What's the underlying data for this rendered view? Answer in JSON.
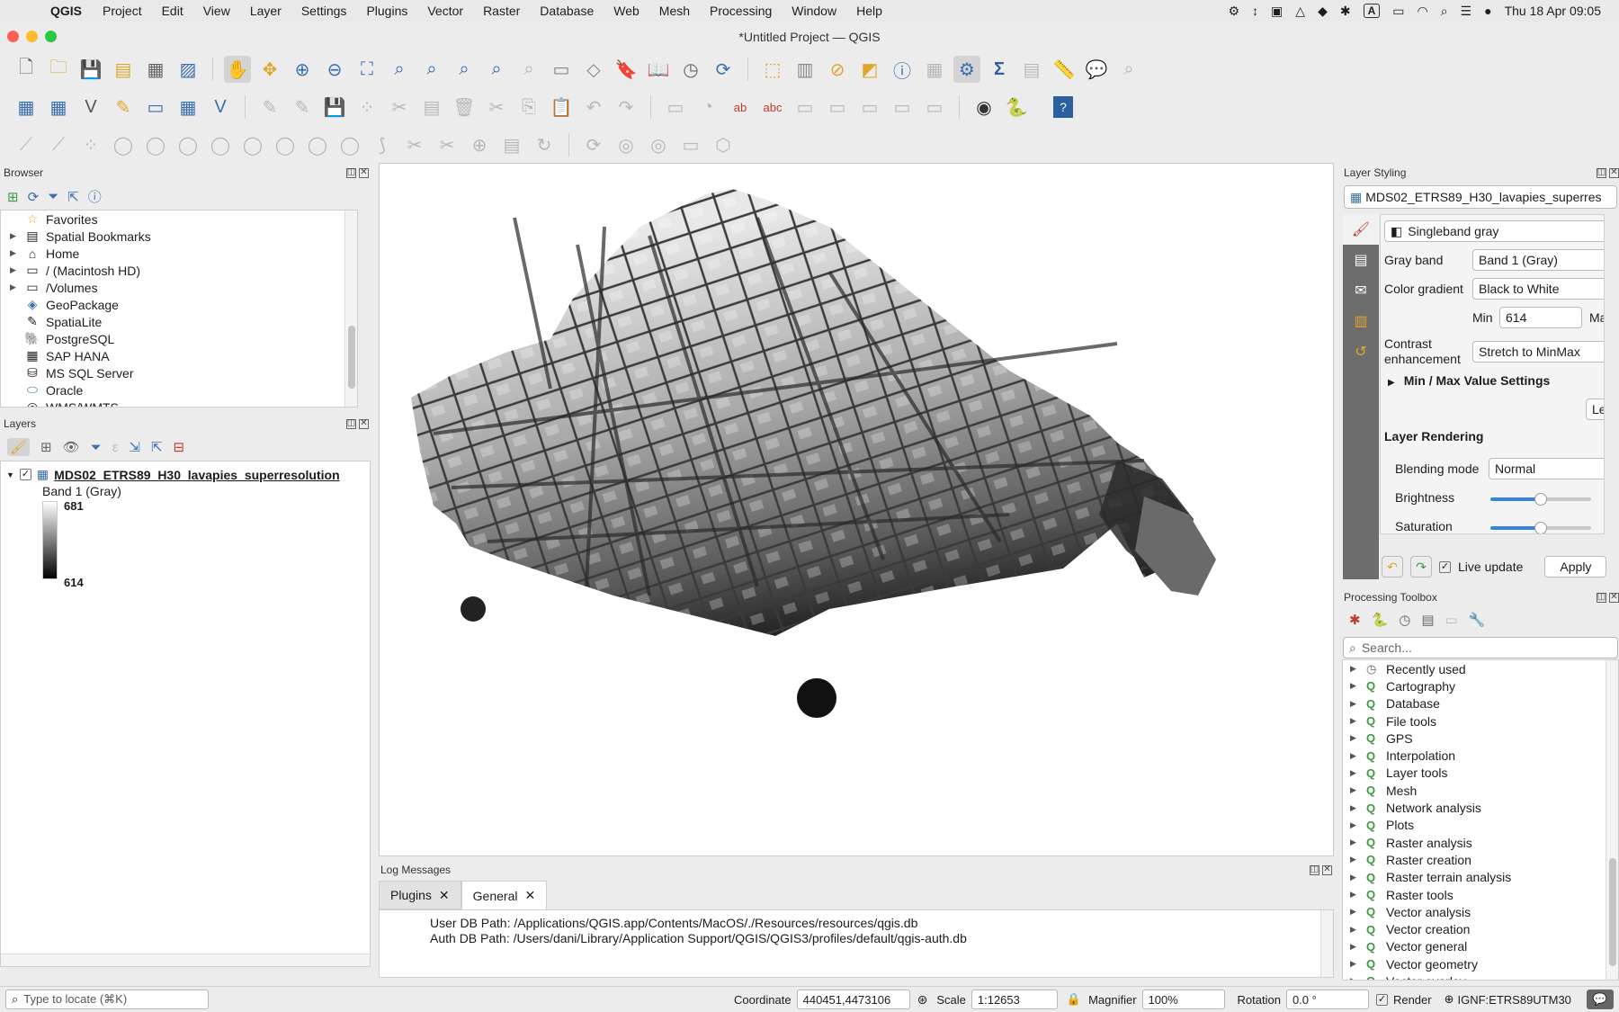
{
  "menubar": {
    "app": "QGIS",
    "items": [
      "Project",
      "Edit",
      "View",
      "Layer",
      "Settings",
      "Plugins",
      "Vector",
      "Raster",
      "Database",
      "Web",
      "Mesh",
      "Processing",
      "Window",
      "Help"
    ],
    "status_icons": [
      "gear-icon",
      "arrows-icon",
      "window-icon",
      "drive-icon",
      "dropbox-icon",
      "bug-icon"
    ],
    "input_indicator": "A",
    "clock": "Thu 18 Apr  09:05"
  },
  "window": {
    "title": "*Untitled Project — QGIS"
  },
  "browser": {
    "title": "Browser",
    "items": [
      {
        "label": "Favorites",
        "icon": "star-icon",
        "expand": false
      },
      {
        "label": "Spatial Bookmarks",
        "icon": "bookmark-icon",
        "expand": true
      },
      {
        "label": "Home",
        "icon": "home-icon",
        "expand": true
      },
      {
        "label": "/ (Macintosh HD)",
        "icon": "folder-icon",
        "expand": true
      },
      {
        "label": "/Volumes",
        "icon": "folder-icon",
        "expand": true
      },
      {
        "label": "GeoPackage",
        "icon": "geopackage-icon",
        "expand": false
      },
      {
        "label": "SpatiaLite",
        "icon": "spatialite-icon",
        "expand": false
      },
      {
        "label": "PostgreSQL",
        "icon": "postgresql-icon",
        "expand": false
      },
      {
        "label": "SAP HANA",
        "icon": "sap-hana-icon",
        "expand": false
      },
      {
        "label": "MS SQL Server",
        "icon": "mssql-icon",
        "expand": false
      },
      {
        "label": "Oracle",
        "icon": "oracle-icon",
        "expand": false
      },
      {
        "label": "WMS/WMTS",
        "icon": "wms-icon",
        "expand": false
      }
    ]
  },
  "layers": {
    "title": "Layers",
    "layer_name": "MDS02_ETRS89_H30_lavapies_superresolution",
    "band": "Band 1 (Gray)",
    "max": "681",
    "min": "614"
  },
  "log": {
    "title": "Log Messages",
    "tabs": [
      "Plugins",
      "General"
    ],
    "active_tab": "General",
    "lines": [
      "User DB Path: /Applications/QGIS.app/Contents/MacOS/./Resources/resources/qgis.db",
      "Auth DB Path: /Users/dani/Library/Application Support/QGIS/QGIS3/profiles/default/qgis-auth.db"
    ]
  },
  "styling": {
    "title": "Layer Styling",
    "layer": "MDS02_ETRS89_H30_lavapies_superres",
    "renderer": "Singleband gray",
    "gray_band_label": "Gray band",
    "gray_band": "Band 1 (Gray)",
    "gradient_label": "Color gradient",
    "gradient": "Black to White",
    "min_label": "Min",
    "min": "614",
    "max_label": "Ma",
    "contrast_label1": "Contrast",
    "contrast_label2": "enhancement",
    "contrast": "Stretch to MinMax",
    "minmax_section": "Min / Max Value Settings",
    "le_button": "Le",
    "rendering_section": "Layer Rendering",
    "blending_label": "Blending mode",
    "blending": "Normal",
    "brightness_label": "Brightness",
    "brightness_level": 0.5,
    "saturation_label": "Saturation",
    "saturation_level": 0.5,
    "live_update": "Live update",
    "apply": "Apply"
  },
  "processing": {
    "title": "Processing Toolbox",
    "search_placeholder": "Search...",
    "items": [
      "Recently used",
      "Cartography",
      "Database",
      "File tools",
      "GPS",
      "Interpolation",
      "Layer tools",
      "Mesh",
      "Network analysis",
      "Plots",
      "Raster analysis",
      "Raster creation",
      "Raster terrain analysis",
      "Raster tools",
      "Vector analysis",
      "Vector creation",
      "Vector general",
      "Vector geometry",
      "Vector overlay"
    ]
  },
  "statusbar": {
    "locate_placeholder": "Type to locate (⌘K)",
    "coordinate_label": "Coordinate",
    "coordinate": "440451,4473106",
    "scale_label": "Scale",
    "scale": "1:12653",
    "magnifier_label": "Magnifier",
    "magnifier": "100%",
    "rotation_label": "Rotation",
    "rotation": "0.0 °",
    "render_label": "Render",
    "crs": "IGNF:ETRS89UTM30"
  }
}
